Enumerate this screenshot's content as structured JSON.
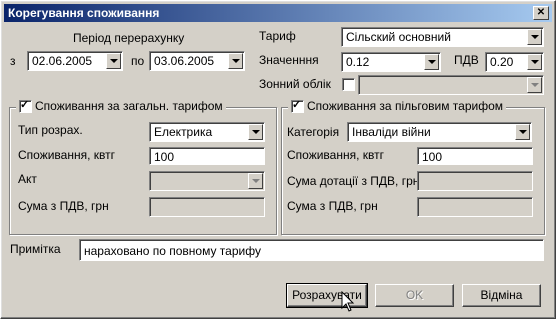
{
  "window": {
    "title": "Корегування споживання"
  },
  "period": {
    "label": "Період перерахунку",
    "from_label": "з",
    "from_value": "02.06.2005",
    "to_label": "по",
    "to_value": "03.06.2005"
  },
  "tariff": {
    "tariff_label": "Тариф",
    "tariff_value": "Сільский основний",
    "value_label": "Значенння",
    "value_value": "0.12",
    "vat_label": "ПДВ",
    "vat_value": "0.20",
    "zone_label": "Зонний облік",
    "zone_checked": false,
    "zone_value": ""
  },
  "general": {
    "legend": "Споживання за загальн. тарифом",
    "checked": true,
    "calc_type_label": "Тип розрах.",
    "calc_type_value": "Електрика",
    "consumption_label": "Споживання, квтг",
    "consumption_value": "100",
    "act_label": "Акт",
    "act_value": "",
    "sum_label": "Сума з ПДВ, грн",
    "sum_value": ""
  },
  "privilege": {
    "legend": "Споживання за пільговим тарифом",
    "checked": true,
    "category_label": "Категорія",
    "category_value": "Інваліди війни",
    "consumption_label": "Споживання, квтг",
    "consumption_value": "100",
    "subsidy_label": "Сума дотації з ПДВ, грн",
    "subsidy_value": "",
    "sum_label": "Сума з ПДВ, грн",
    "sum_value": ""
  },
  "note": {
    "label": "Примітка",
    "value": "нараховано по повному тарифу"
  },
  "buttons": {
    "calculate": "Розрахувати",
    "ok": "OK",
    "cancel": "Відміна"
  }
}
